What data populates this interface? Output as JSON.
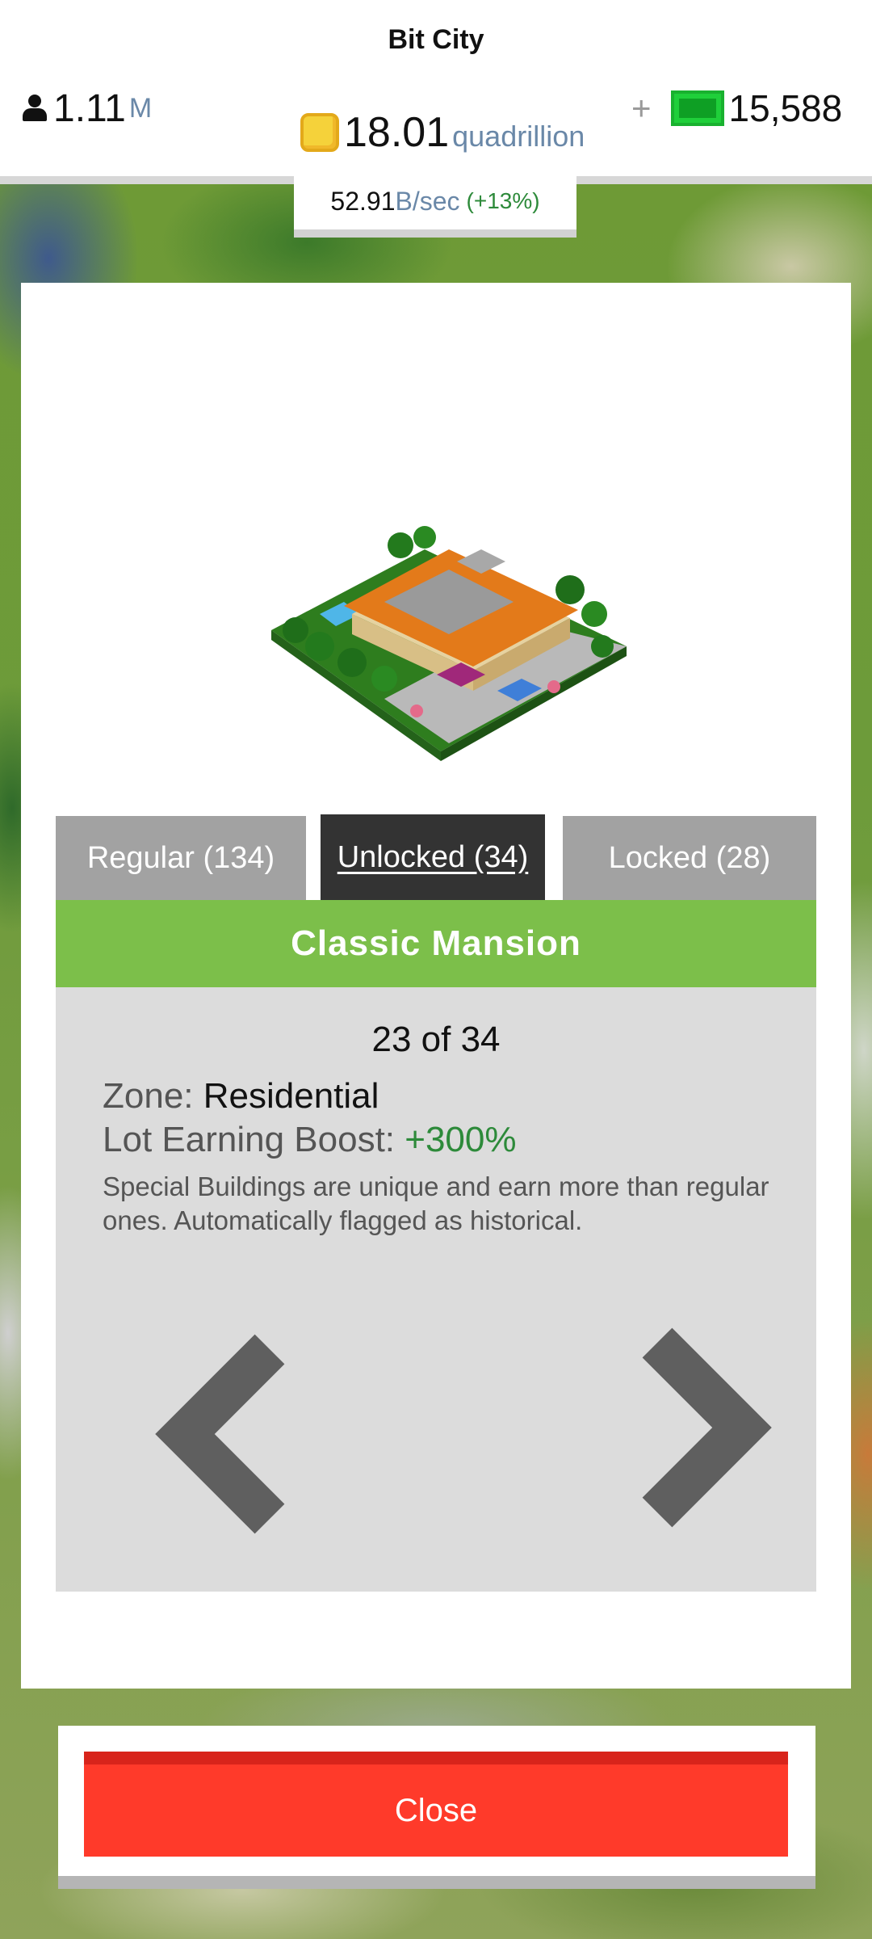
{
  "header": {
    "city_name": "Bit City",
    "population": {
      "value": "1.11",
      "unit": "M"
    },
    "coins": {
      "value": "18.01",
      "unit": "quadrillion"
    },
    "cash": {
      "plus": "+",
      "value": "15,588"
    },
    "rate": {
      "value": "52.91",
      "unit": "B/sec",
      "bonus": "(+13%)"
    }
  },
  "tabs": [
    {
      "label": "Regular (134)",
      "active": false
    },
    {
      "label": "Unlocked (34)",
      "active": true
    },
    {
      "label": "Locked (28)",
      "active": false
    }
  ],
  "building": {
    "name": "Classic Mansion",
    "counter": "23 of 34",
    "zone_label": "Zone: ",
    "zone_value": "Residential",
    "boost_label": "Lot Earning Boost: ",
    "boost_value": "+300%",
    "description": "Special Buildings are unique and earn more than regular ones. Automatically flagged as historical."
  },
  "close_label": "Close",
  "colors": {
    "title_bar": "#7cbf4a",
    "active_tab": "#333333",
    "inactive_tab": "#a2a2a2",
    "close_button": "#ff3a2a",
    "boost_green": "#2d8a3a",
    "unit_blue": "#6a88a8"
  },
  "icons": [
    "person-icon",
    "coin-icon",
    "cash-bill-icon",
    "chevron-left-icon",
    "chevron-right-icon"
  ]
}
